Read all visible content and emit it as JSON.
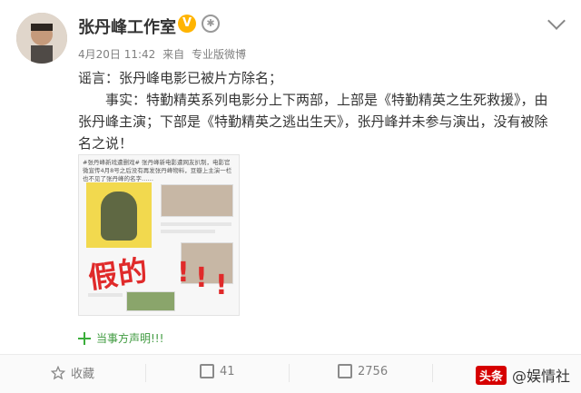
{
  "post": {
    "author": "张丹峰工作室",
    "time": "4月20日 11:42",
    "source_prefix": "来自",
    "source": "专业版微博",
    "content": [
      "谣言：张丹峰电影已被片方除名；",
      "事实：特勤精英系列电影分上下两部，上部是《特勤精英之生死救援》，由张丹峰主演；下部是《特勤精英之逃出生天》，张丹峰并未参与演出，没有被除名之说！"
    ],
    "attachment_text": "#张丹峰新戏遭删戏# 张丹峰新电影遭网友扒制，电影官微宣传4月8号之后没有再发张丹峰物料，豆瓣上主演一栏也不见了张丹峰的名字……",
    "fake_stamp": "假的",
    "link_text": "当事方声明!!!"
  },
  "badges": {
    "verified": "V",
    "second": "✱"
  },
  "actions": {
    "favorite": "收藏",
    "repost_count": "41",
    "comment_count": "2756"
  },
  "watermark": {
    "logo": "头条",
    "text": "@娱情社"
  },
  "colors": {
    "link": "#3f9a3f",
    "stamp": "#e02a2a",
    "meta": "#808080"
  }
}
